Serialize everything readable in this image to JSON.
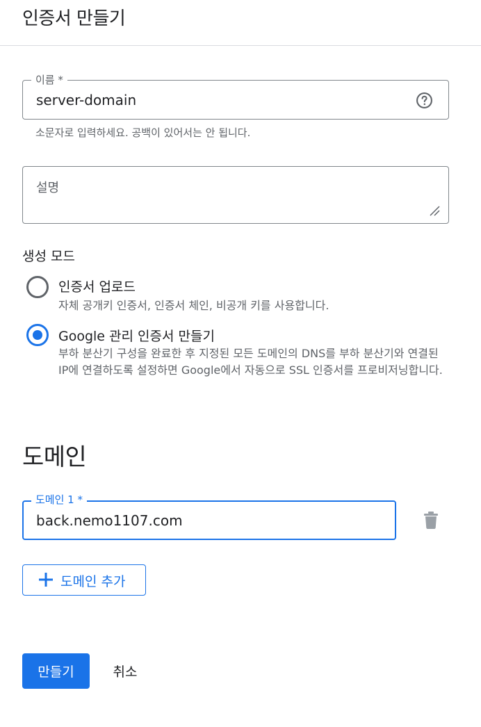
{
  "header": {
    "title": "인증서 만들기"
  },
  "name_field": {
    "label": "이름 *",
    "value": "server-domain",
    "hint": "소문자로 입력하세요. 공백이 있어서는 안 됩니다.",
    "help_icon": "help-circle-icon"
  },
  "description_field": {
    "placeholder": "설명"
  },
  "creation_mode": {
    "heading": "생성 모드",
    "options": [
      {
        "label": "인증서 업로드",
        "description": "자체 공개키 인증서, 인증서 체인, 비공개 키를 사용합니다.",
        "selected": false
      },
      {
        "label": "Google 관리 인증서 만들기",
        "description": "부하 분산기 구성을 완료한 후 지정된 모든 도메인의 DNS를 부하 분산기와 연결된 IP에 연결하도록 설정하면 Google에서 자동으로 SSL 인증서를 프로비저닝합니다.",
        "selected": true
      }
    ]
  },
  "domains": {
    "heading": "도메인",
    "items": [
      {
        "label": "도메인 1 *",
        "value": "back.nemo1107.com"
      }
    ],
    "add_label": "도메인 추가"
  },
  "actions": {
    "create_label": "만들기",
    "cancel_label": "취소"
  },
  "colors": {
    "accent": "#1a73e8",
    "text": "#202124",
    "secondary_text": "#5f6368",
    "border": "#80868b"
  }
}
